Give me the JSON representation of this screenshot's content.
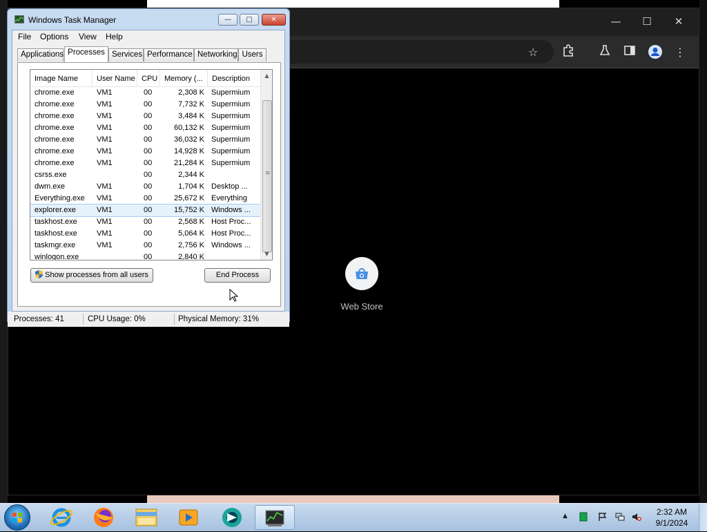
{
  "background": {
    "web_store_label": "Web Store"
  },
  "task_manager": {
    "title": "Windows Task Manager",
    "menu": [
      "File",
      "Options",
      "View",
      "Help"
    ],
    "tabs": [
      "Applications",
      "Processes",
      "Services",
      "Performance",
      "Networking",
      "Users"
    ],
    "active_tab": "Processes",
    "columns": [
      "Image Name",
      "User Name",
      "CPU",
      "Memory (...",
      "Description"
    ],
    "processes": [
      {
        "image": "chrome.exe",
        "user": "VM1",
        "cpu": "00",
        "memory": "2,308 K",
        "desc": "Supermium"
      },
      {
        "image": "chrome.exe",
        "user": "VM1",
        "cpu": "00",
        "memory": "7,732 K",
        "desc": "Supermium"
      },
      {
        "image": "chrome.exe",
        "user": "VM1",
        "cpu": "00",
        "memory": "3,484 K",
        "desc": "Supermium"
      },
      {
        "image": "chrome.exe",
        "user": "VM1",
        "cpu": "00",
        "memory": "60,132 K",
        "desc": "Supermium"
      },
      {
        "image": "chrome.exe",
        "user": "VM1",
        "cpu": "00",
        "memory": "36,032 K",
        "desc": "Supermium"
      },
      {
        "image": "chrome.exe",
        "user": "VM1",
        "cpu": "00",
        "memory": "14,928 K",
        "desc": "Supermium"
      },
      {
        "image": "chrome.exe",
        "user": "VM1",
        "cpu": "00",
        "memory": "21,284 K",
        "desc": "Supermium"
      },
      {
        "image": "csrss.exe",
        "user": "",
        "cpu": "00",
        "memory": "2,344 K",
        "desc": ""
      },
      {
        "image": "dwm.exe",
        "user": "VM1",
        "cpu": "00",
        "memory": "1,704 K",
        "desc": "Desktop ..."
      },
      {
        "image": "Everything.exe",
        "user": "VM1",
        "cpu": "00",
        "memory": "25,672 K",
        "desc": "Everything"
      },
      {
        "image": "explorer.exe",
        "user": "VM1",
        "cpu": "00",
        "memory": "15,752 K",
        "desc": "Windows ..."
      },
      {
        "image": "taskhost.exe",
        "user": "VM1",
        "cpu": "00",
        "memory": "2,568 K",
        "desc": "Host Proc..."
      },
      {
        "image": "taskhost.exe",
        "user": "VM1",
        "cpu": "00",
        "memory": "5,064 K",
        "desc": "Host Proc..."
      },
      {
        "image": "taskmgr.exe",
        "user": "VM1",
        "cpu": "00",
        "memory": "2,756 K",
        "desc": "Windows ..."
      },
      {
        "image": "winlogon.exe",
        "user": "",
        "cpu": "00",
        "memory": "2,840 K",
        "desc": ""
      }
    ],
    "selected_process": "explorer.exe",
    "show_all_button": "Show processes from all users",
    "end_process_button": "End Process",
    "status": {
      "processes": "Processes: 41",
      "cpu": "CPU Usage: 0%",
      "memory": "Physical Memory: 31%"
    }
  },
  "taskbar": {
    "apps": [
      "internet-explorer-icon",
      "firefox-icon",
      "file-explorer-icon",
      "media-player-icon",
      "supermium-icon",
      "task-manager-icon"
    ],
    "active_app": "task-manager-icon",
    "time": "2:32 AM",
    "date": "9/1/2024"
  }
}
